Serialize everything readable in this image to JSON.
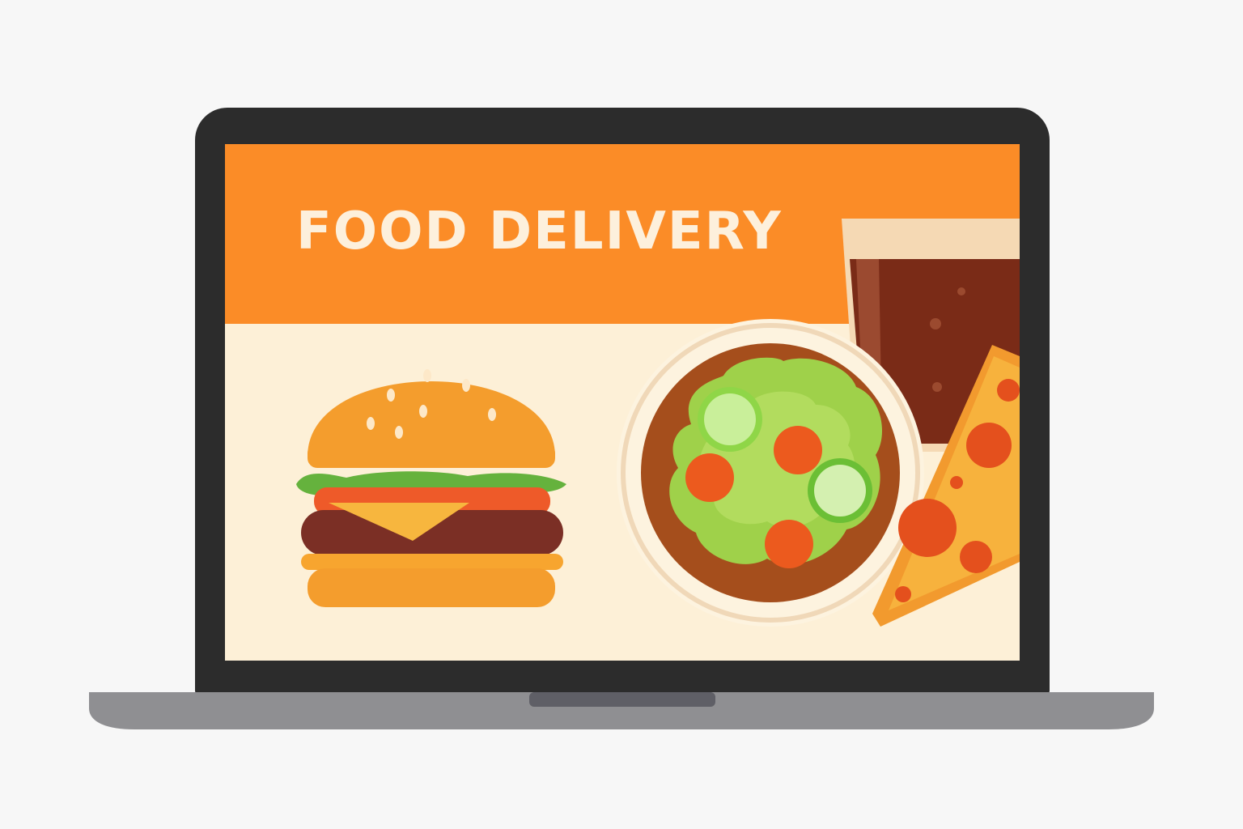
{
  "app": {
    "title": "FOOD DELIVERY"
  },
  "illustrations": [
    {
      "name": "burger",
      "icon": "burger-icon"
    },
    {
      "name": "salad-bowl",
      "icon": "salad-bowl-icon"
    },
    {
      "name": "soda-glass",
      "icon": "soda-glass-icon"
    },
    {
      "name": "pizza-slice",
      "icon": "pizza-slice-icon"
    }
  ],
  "colors": {
    "page_background": "#f7f7f7",
    "bezel": "#2c2c2c",
    "header": "#fb8c27",
    "screen_background": "#fdf0d7",
    "title_text": "#fdf0dc",
    "laptop_base": "#8f8f92"
  }
}
